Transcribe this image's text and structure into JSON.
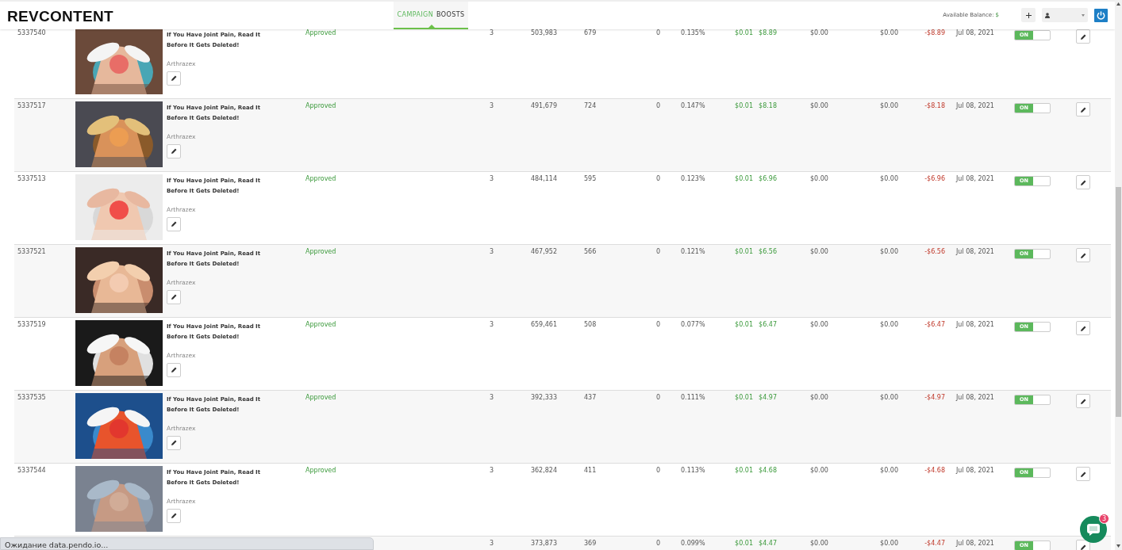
{
  "header": {
    "logo": "REVCONTENT",
    "nav_tab": {
      "words": [
        "CAMPAIGN",
        "BOOSTS"
      ],
      "selected": true
    },
    "balance_label": "Available Balance:",
    "balance_value": "$"
  },
  "rows": [
    {
      "id": "5337540",
      "title": "If You Have Joint Pain, Read It Before It Gets Deleted!",
      "brand": "Arthrazex",
      "status": "Approved",
      "values": [
        "3",
        "503,983",
        "679",
        "0",
        "0.135%",
        "$0.01",
        "$8.89",
        "$0.00",
        "$0.00",
        "-$8.89"
      ],
      "date": "Jul 08, 2021",
      "toggle": {
        "label": "ON",
        "on": true
      }
    },
    {
      "id": "5337517",
      "title": "If You Have Joint Pain, Read It Before It Gets Deleted!",
      "brand": "Arthrazex",
      "status": "Approved",
      "values": [
        "3",
        "491,679",
        "724",
        "0",
        "0.147%",
        "$0.01",
        "$8.18",
        "$0.00",
        "$0.00",
        "-$8.18"
      ],
      "date": "Jul 08, 2021",
      "toggle": {
        "label": "ON",
        "on": true
      }
    },
    {
      "id": "5337513",
      "title": "If You Have Joint Pain, Read It Before It Gets Deleted!",
      "brand": "Arthrazex",
      "status": "Approved",
      "values": [
        "3",
        "484,114",
        "595",
        "0",
        "0.123%",
        "$0.01",
        "$6.96",
        "$0.00",
        "$0.00",
        "-$6.96"
      ],
      "date": "Jul 08, 2021",
      "toggle": {
        "label": "ON",
        "on": true
      }
    },
    {
      "id": "5337521",
      "title": "If You Have Joint Pain, Read It Before It Gets Deleted!",
      "brand": "Arthrazex",
      "status": "Approved",
      "values": [
        "3",
        "467,952",
        "566",
        "0",
        "0.121%",
        "$0.01",
        "$6.56",
        "$0.00",
        "$0.00",
        "-$6.56"
      ],
      "date": "Jul 08, 2021",
      "toggle": {
        "label": "ON",
        "on": true
      }
    },
    {
      "id": "5337519",
      "title": "If You Have Joint Pain, Read It Before It Gets Deleted!",
      "brand": "Arthrazex",
      "status": "Approved",
      "values": [
        "3",
        "659,461",
        "508",
        "0",
        "0.077%",
        "$0.01",
        "$6.47",
        "$0.00",
        "$0.00",
        "-$6.47"
      ],
      "date": "Jul 08, 2021",
      "toggle": {
        "label": "ON",
        "on": true
      }
    },
    {
      "id": "5337535",
      "title": "If You Have Joint Pain, Read It Before It Gets Deleted!",
      "brand": "Arthrazex",
      "status": "Approved",
      "values": [
        "3",
        "392,333",
        "437",
        "0",
        "0.111%",
        "$0.01",
        "$4.97",
        "$0.00",
        "$0.00",
        "-$4.97"
      ],
      "date": "Jul 08, 2021",
      "toggle": {
        "label": "ON",
        "on": true
      }
    },
    {
      "id": "5337544",
      "title": "If You Have Joint Pain, Read It Before It Gets Deleted!",
      "brand": "Arthrazex",
      "status": "Approved",
      "values": [
        "3",
        "362,824",
        "411",
        "0",
        "0.113%",
        "$0.01",
        "$4.68",
        "$0.00",
        "$0.00",
        "-$4.68"
      ],
      "date": "Jul 08, 2021",
      "toggle": {
        "label": "ON",
        "on": true
      }
    },
    {
      "values": [
        "3",
        "373,873",
        "369",
        "0",
        "0.099%",
        "$0.01",
        "$4.47",
        "$0.00",
        "$0.00",
        "-$4.47"
      ],
      "date": "Jul 08, 2021",
      "toggle": {
        "label": "ON",
        "on": true
      }
    }
  ],
  "chat": {
    "badge": "3"
  },
  "status_bar": "Ожидание data.pendo.io..."
}
